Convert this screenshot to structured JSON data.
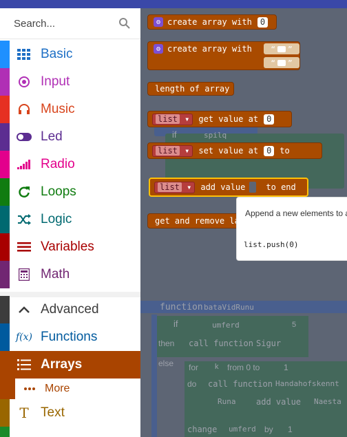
{
  "search": {
    "placeholder": "Search..."
  },
  "categories": [
    {
      "label": "Basic",
      "icon": "grid-icon",
      "color": "#1e90ff",
      "text_color": "#1d6fc5"
    },
    {
      "label": "Input",
      "icon": "radio-target-icon",
      "color": "#b02fb5",
      "text_color": "#b02fb5"
    },
    {
      "label": "Music",
      "icon": "headphones-icon",
      "color": "#e63022",
      "text_color": "#d8441c"
    },
    {
      "label": "Led",
      "icon": "toggle-icon",
      "color": "#5c2d91",
      "text_color": "#5c2d91"
    },
    {
      "label": "Radio",
      "icon": "signal-bars-icon",
      "color": "#e3008c",
      "text_color": "#e3008c"
    },
    {
      "label": "Loops",
      "icon": "refresh-icon",
      "color": "#107c10",
      "text_color": "#107c10"
    },
    {
      "label": "Logic",
      "icon": "shuffle-icon",
      "color": "#006970",
      "text_color": "#006970"
    },
    {
      "label": "Variables",
      "icon": "list-lines-icon",
      "color": "#a80000",
      "text_color": "#a80000"
    },
    {
      "label": "Math",
      "icon": "calculator-icon",
      "color": "#712672",
      "text_color": "#712672"
    },
    {
      "label": "Advanced",
      "icon": "chevron-up-icon",
      "color": "#3c3c3c",
      "text_color": "#3c3c3c"
    },
    {
      "label": "Functions",
      "icon": "fx-icon",
      "color": "#005a9e",
      "text_color": "#005a9e"
    },
    {
      "label": "Arrays",
      "icon": "list-icon",
      "color": "#a94400",
      "text_color": "#ffffff"
    },
    {
      "label": "More",
      "icon": "dots-icon",
      "color": "#a94400",
      "text_color": "#a94400"
    },
    {
      "label": "Text",
      "icon": "text-icon",
      "color": "#996600",
      "text_color": "#996600"
    }
  ],
  "blocks": {
    "create_array": "create array with",
    "create_array_value": "0",
    "create_array2": "create array with",
    "quote_open": "“",
    "quote_close": "”",
    "length": "length of array",
    "get_value_var": "list",
    "get_value": "get value at",
    "get_value_index": "0",
    "set_value_var": "list",
    "set_value": "set value at",
    "set_value_index": "0",
    "set_value_to": "to",
    "add_value_var": "list",
    "add_value": "add value",
    "add_value_end": "to end",
    "get_remove": "get and remove la"
  },
  "tooltip": {
    "description": "Append a new elements to a",
    "code": "list.push(0)"
  },
  "background_code": {
    "if": "if",
    "spilq": "spilq",
    "function": "function",
    "fn_name": "bataVidRunu",
    "umferd": "umferd",
    "num5": "5",
    "then": "then",
    "call_function": "call function",
    "sigur": "Sigur",
    "else": "else",
    "for": "for",
    "k": "k",
    "from": "from 0 to",
    "num1": "1",
    "do": "do",
    "handahofskennt": "Handahofskennt",
    "runa": "Runa",
    "add_value": "add value",
    "naesta": "Naesta",
    "change": "change",
    "umferd2": "umferd",
    "by": "by",
    "num1b": "1"
  }
}
